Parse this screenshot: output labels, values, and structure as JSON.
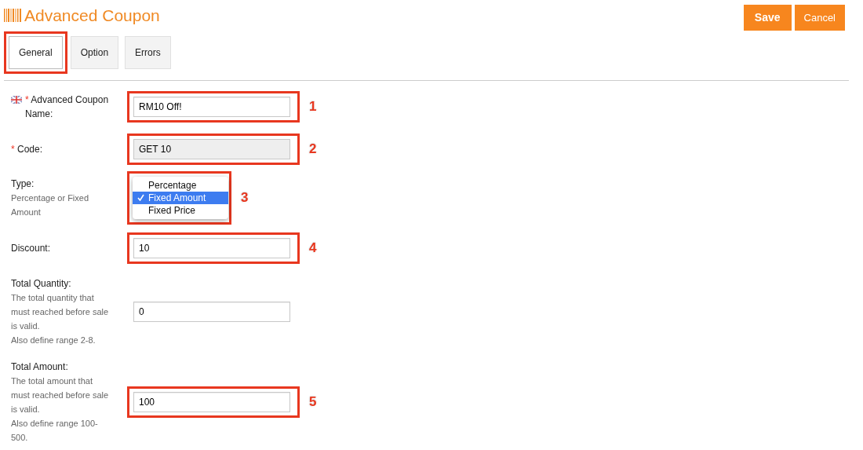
{
  "header": {
    "title": "Advanced Coupon",
    "buttons": [
      "Save",
      "Cancel"
    ]
  },
  "tabs": [
    {
      "label": "General",
      "selected": true,
      "annotated": true
    },
    {
      "label": "Option",
      "selected": false,
      "annotated": false
    },
    {
      "label": "Errors",
      "selected": false,
      "annotated": false
    }
  ],
  "fields": [
    {
      "kind": "text",
      "label": "Advanced Coupon Name:",
      "flag": true,
      "required_mark": "*",
      "value": "RM10 Off!",
      "disabled": false,
      "annotation": "1"
    },
    {
      "kind": "text",
      "label": "Code:",
      "flag": false,
      "required_mark": "*",
      "value": "GET 10",
      "disabled": true,
      "annotation": "2"
    },
    {
      "kind": "select",
      "label": "Type:",
      "help": [
        "Percentage or Fixed",
        "Amount"
      ],
      "options": [
        {
          "label": "Percentage",
          "selected": false
        },
        {
          "label": "Fixed Amount",
          "selected": true
        },
        {
          "label": "Fixed Price",
          "selected": false
        }
      ],
      "annotation": "3"
    },
    {
      "kind": "text",
      "label": "Discount:",
      "flag": false,
      "value": "10",
      "disabled": false,
      "annotation": "4"
    },
    {
      "kind": "text",
      "label": "Total Quantity:",
      "flag": false,
      "help": [
        "The total quantity that",
        "must reached before sale",
        "is valid.",
        "Also define range 2-8."
      ],
      "value": "0",
      "disabled": false
    },
    {
      "kind": "text",
      "label": "Total Amount:",
      "flag": false,
      "help": [
        "The total amount that",
        "must reached before sale",
        "is valid.",
        "Also define range 100-",
        "500."
      ],
      "value": "100",
      "disabled": false,
      "annotation": "5"
    }
  ]
}
